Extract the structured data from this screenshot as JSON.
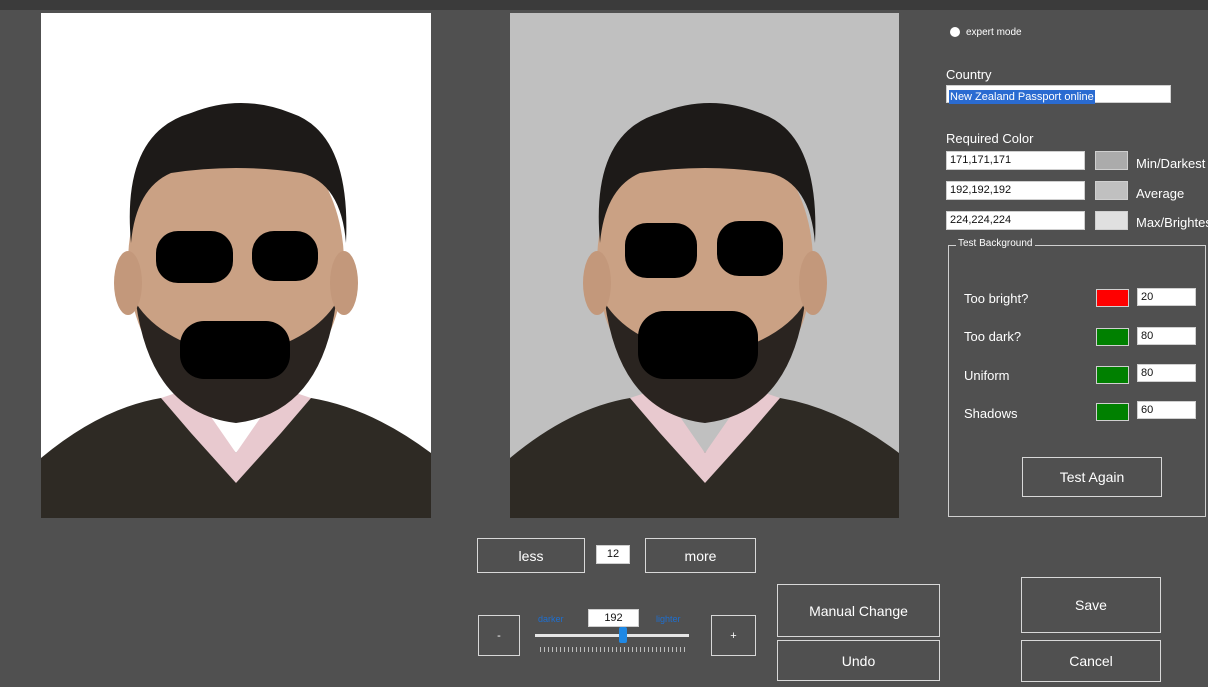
{
  "photos": {
    "original_bg": "#ffffff",
    "processed_bg": "#c0c0c0"
  },
  "options": {
    "expert_mode_label": "expert mode"
  },
  "country": {
    "label": "Country",
    "value": "New Zealand Passport online"
  },
  "required_color": {
    "label": "Required Color",
    "rows": [
      {
        "value": "171,171,171",
        "swatch": "#ababab",
        "label": "Min/Darkest"
      },
      {
        "value": "192,192,192",
        "swatch": "#c0c0c0",
        "label": "Average"
      },
      {
        "value": "224,224,224",
        "swatch": "#e0e0e0",
        "label": "Max/Brightest"
      }
    ]
  },
  "test_background": {
    "label": "Test Background",
    "rows": [
      {
        "label": "Too bright?",
        "status_color": "#ff0000",
        "value": "20"
      },
      {
        "label": "Too dark?",
        "status_color": "#008000",
        "value": "80"
      },
      {
        "label": "Uniform",
        "status_color": "#008000",
        "value": "80"
      },
      {
        "label": "Shadows",
        "status_color": "#008000",
        "value": "60"
      }
    ],
    "test_again_label": "Test Again"
  },
  "adjust": {
    "less_label": "less",
    "amount": "12",
    "more_label": "more"
  },
  "brightness": {
    "minus_label": "-",
    "plus_label": "+",
    "darker_label": "darker",
    "lighter_label": "lighter",
    "value": "192",
    "slider_fraction": 0.57
  },
  "actions": {
    "manual_change_label": "Manual Change",
    "undo_label": "Undo",
    "save_label": "Save",
    "cancel_label": "Cancel"
  }
}
